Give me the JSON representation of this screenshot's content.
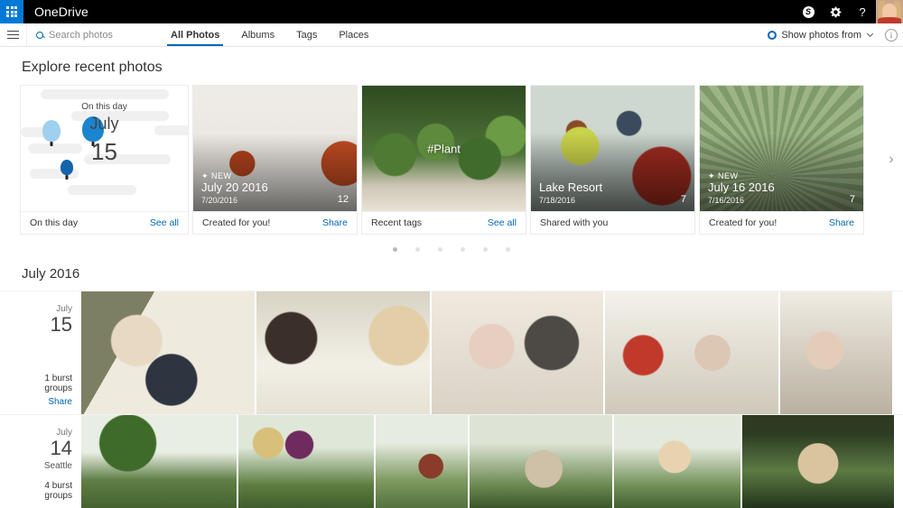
{
  "suite": {
    "app_launcher_icon": "waffle-grid-icon",
    "title": "OneDrive",
    "skype_icon": "skype-icon",
    "settings_icon": "gear-icon",
    "help_icon": "help-icon",
    "help_label": "?",
    "avatar_icon": "user-avatar",
    "accent_color": "#0078d7",
    "bar_color": "#000000"
  },
  "command_bar": {
    "menu_icon": "hamburger-icon",
    "search": {
      "icon": "search-icon",
      "placeholder": "Search photos",
      "value": ""
    },
    "tabs": [
      {
        "label": "All Photos",
        "active": true
      },
      {
        "label": "Albums",
        "active": false
      },
      {
        "label": "Tags",
        "active": false
      },
      {
        "label": "Places",
        "active": false
      }
    ],
    "show_photos_from": {
      "icon": "gear-icon",
      "label": "Show photos from",
      "chevron": "chevron-down-icon"
    },
    "info_icon": "info-icon",
    "info_label": "i",
    "link_color": "#0067b8"
  },
  "explore": {
    "heading": "Explore recent photos",
    "next_arrow": "chevron-right-icon",
    "cards": [
      {
        "kind": "on-this-day",
        "illustration": {
          "label": "On this day",
          "month": "July",
          "day": "15"
        },
        "footer_label": "On this day",
        "footer_action": "See all"
      },
      {
        "kind": "photo",
        "badge_new": "NEW",
        "sparkle_icon": "sparkle-icon",
        "title": "July 20 2016",
        "date": "7/20/2016",
        "count": "12",
        "footer_label": "Created for you!",
        "footer_action": "Share"
      },
      {
        "kind": "photo",
        "tag": "#Plant",
        "footer_label": "Recent tags",
        "footer_action": "See all"
      },
      {
        "kind": "photo",
        "title": "Lake Resort",
        "date": "7/18/2016",
        "count": "7",
        "footer_label": "Shared with you",
        "footer_action": ""
      },
      {
        "kind": "photo",
        "badge_new": "NEW",
        "sparkle_icon": "sparkle-icon",
        "title": "July 16 2016",
        "date": "7/16/2016",
        "count": "7",
        "footer_label": "Created for you!",
        "footer_action": "Share"
      }
    ],
    "pager": {
      "count": 6,
      "active_index": 0
    }
  },
  "timeline": {
    "month_heading": "July 2016",
    "days": [
      {
        "month": "July",
        "day": "15",
        "location": "",
        "burst_groups": "1 burst groups",
        "share": "Share"
      },
      {
        "month": "July",
        "day": "14",
        "location": "Seattle",
        "burst_groups": "4 burst groups",
        "share": ""
      }
    ]
  }
}
